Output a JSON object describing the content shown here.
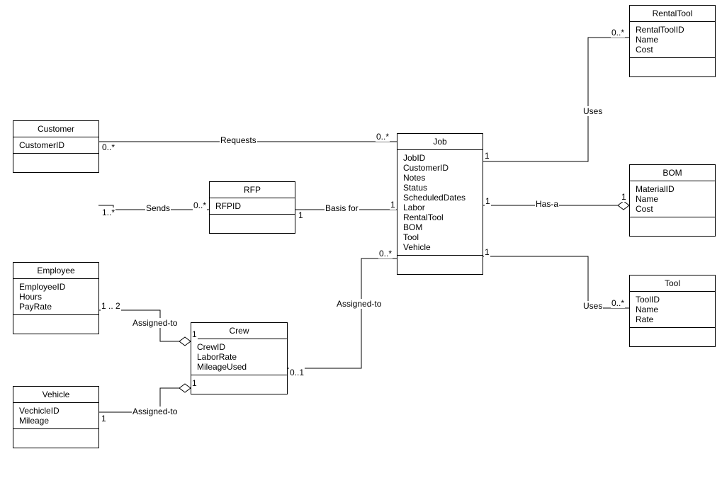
{
  "classes": {
    "customer": {
      "name": "Customer",
      "attrs": "CustomerID"
    },
    "rfp": {
      "name": "RFP",
      "attrs": "RFPID"
    },
    "job": {
      "name": "Job",
      "attrs": "JobID\nCustomerID\nNotes\nStatus\nScheduledDates\nLabor\nRentalTool\nBOM\nTool\nVehicle"
    },
    "rentaltool": {
      "name": "RentalTool",
      "attrs": "RentalToolID\nName\nCost"
    },
    "bom": {
      "name": "BOM",
      "attrs": "MaterialID\nName\nCost"
    },
    "tool": {
      "name": "Tool",
      "attrs": "ToolID\nName\nRate"
    },
    "employee": {
      "name": "Employee",
      "attrs": "EmployeeID\nHours\nPayRate"
    },
    "vehicle": {
      "name": "Vehicle",
      "attrs": "VechicleID\nMileage"
    },
    "crew": {
      "name": "Crew",
      "attrs": "CrewID\nLaborRate\nMileageUsed"
    }
  },
  "relations": {
    "requests": {
      "label": "Requests",
      "m1": "0..*",
      "m2": "0..*"
    },
    "sends": {
      "label": "Sends",
      "m1": "1..*",
      "m2": "0..*"
    },
    "basisfor": {
      "label": "Basis for",
      "m1": "1",
      "m2": "1"
    },
    "assignedEmp": {
      "label": "Assigned-to",
      "m1": "1 .. 2",
      "m2": "1"
    },
    "assignedVeh": {
      "label": "Assigned-to",
      "m1": "1",
      "m2": "1"
    },
    "assignedCrew": {
      "label": "Assigned-to",
      "m1": "0..1",
      "m2": "0..*"
    },
    "hasa": {
      "label": "Has-a",
      "m1": "1",
      "m2": "1"
    },
    "usesRental": {
      "label": "Uses",
      "m1": "1",
      "m2": "0..*"
    },
    "usesTool": {
      "label": "Uses",
      "m1": "1",
      "m2": "0..*"
    }
  },
  "chart_data": {
    "type": "table",
    "diagram": "UML Class Diagram",
    "entities": [
      {
        "name": "Customer",
        "attributes": [
          "CustomerID"
        ]
      },
      {
        "name": "RFP",
        "attributes": [
          "RFPID"
        ]
      },
      {
        "name": "Job",
        "attributes": [
          "JobID",
          "CustomerID",
          "Notes",
          "Status",
          "ScheduledDates",
          "Labor",
          "RentalTool",
          "BOM",
          "Tool",
          "Vehicle"
        ]
      },
      {
        "name": "RentalTool",
        "attributes": [
          "RentalToolID",
          "Name",
          "Cost"
        ]
      },
      {
        "name": "BOM",
        "attributes": [
          "MaterialID",
          "Name",
          "Cost"
        ]
      },
      {
        "name": "Tool",
        "attributes": [
          "ToolID",
          "Name",
          "Rate"
        ]
      },
      {
        "name": "Employee",
        "attributes": [
          "EmployeeID",
          "Hours",
          "PayRate"
        ]
      },
      {
        "name": "Vehicle",
        "attributes": [
          "VechicleID",
          "Mileage"
        ]
      },
      {
        "name": "Crew",
        "attributes": [
          "CrewID",
          "LaborRate",
          "MileageUsed"
        ]
      }
    ],
    "relationships": [
      {
        "from": "Customer",
        "to": "Job",
        "label": "Requests",
        "multiplicity": [
          "0..*",
          "0..*"
        ],
        "type": "association"
      },
      {
        "from": "Customer",
        "to": "RFP",
        "label": "Sends",
        "multiplicity": [
          "1..*",
          "0..*"
        ],
        "type": "association"
      },
      {
        "from": "RFP",
        "to": "Job",
        "label": "Basis for",
        "multiplicity": [
          "1",
          "1"
        ],
        "type": "association"
      },
      {
        "from": "Employee",
        "to": "Crew",
        "label": "Assigned-to",
        "multiplicity": [
          "1 .. 2",
          "1"
        ],
        "type": "aggregation"
      },
      {
        "from": "Vehicle",
        "to": "Crew",
        "label": "Assigned-to",
        "multiplicity": [
          "1",
          "1"
        ],
        "type": "aggregation"
      },
      {
        "from": "Crew",
        "to": "Job",
        "label": "Assigned-to",
        "multiplicity": [
          "0..1",
          "0..*"
        ],
        "type": "association"
      },
      {
        "from": "Job",
        "to": "BOM",
        "label": "Has-a",
        "multiplicity": [
          "1",
          "1"
        ],
        "type": "aggregation"
      },
      {
        "from": "Job",
        "to": "RentalTool",
        "label": "Uses",
        "multiplicity": [
          "1",
          "0..*"
        ],
        "type": "association"
      },
      {
        "from": "Job",
        "to": "Tool",
        "label": "Uses",
        "multiplicity": [
          "1",
          "0..*"
        ],
        "type": "association"
      }
    ]
  }
}
